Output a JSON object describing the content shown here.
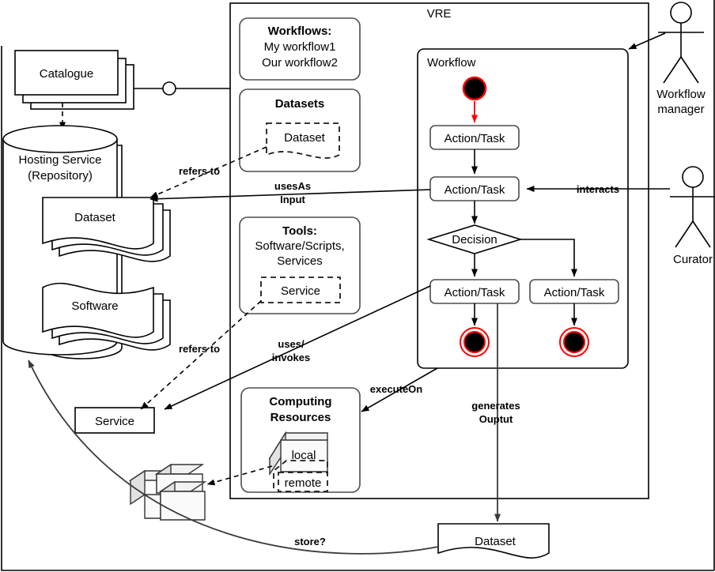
{
  "diagram": {
    "title": "VRE",
    "vre_label": "VRE",
    "workflow_frame_label": "Workflow"
  },
  "left": {
    "catalogue": "Catalogue",
    "hosting_service_line1": "Hosting Service",
    "hosting_service_line2": "(Repository)",
    "dataset": "Dataset",
    "software": "Software",
    "service": "Service"
  },
  "panels": {
    "workflows": {
      "title": "Workflows:",
      "items": [
        "My workflow1",
        "Our workflow2"
      ]
    },
    "datasets": {
      "title": "Datasets",
      "inner": "Dataset"
    },
    "tools": {
      "title": "Tools:",
      "line1": "Software/Scripts,",
      "line2": "Services",
      "inner": "Service"
    },
    "computing": {
      "title_line1": "Computing",
      "title_line2": "Resources",
      "local": "local",
      "remote": "remote"
    }
  },
  "workflow": {
    "action1": "Action/Task",
    "action2": "Action/Task",
    "decision": "Decision",
    "action3": "Action/Task",
    "action4": "Action/Task"
  },
  "actors": [
    {
      "name": "workflow-manager",
      "line1": "Workflow",
      "line2": "manager"
    },
    {
      "name": "curator",
      "line1": "Curator",
      "line2": ""
    }
  ],
  "edges": {
    "refers_to_dataset": "refers to",
    "refers_to_service": "refers to",
    "uses_as_input_l1": "usesAs",
    "uses_as_input_l2": "Input",
    "uses_invokes_l1": "uses/",
    "uses_invokes_l2": "invokes",
    "interacts": "interacts",
    "execute_on": "executeOn",
    "generates_output_l1": "generates",
    "generates_output_l2": "Ouptut",
    "store": "store?"
  },
  "bottom": {
    "dataset": "Dataset"
  },
  "colors": {
    "accent_red": "#ff0000",
    "node_black": "#000000",
    "line_gray": "#3a3a3a",
    "stroke": "#000000",
    "background": "#ffffff"
  }
}
